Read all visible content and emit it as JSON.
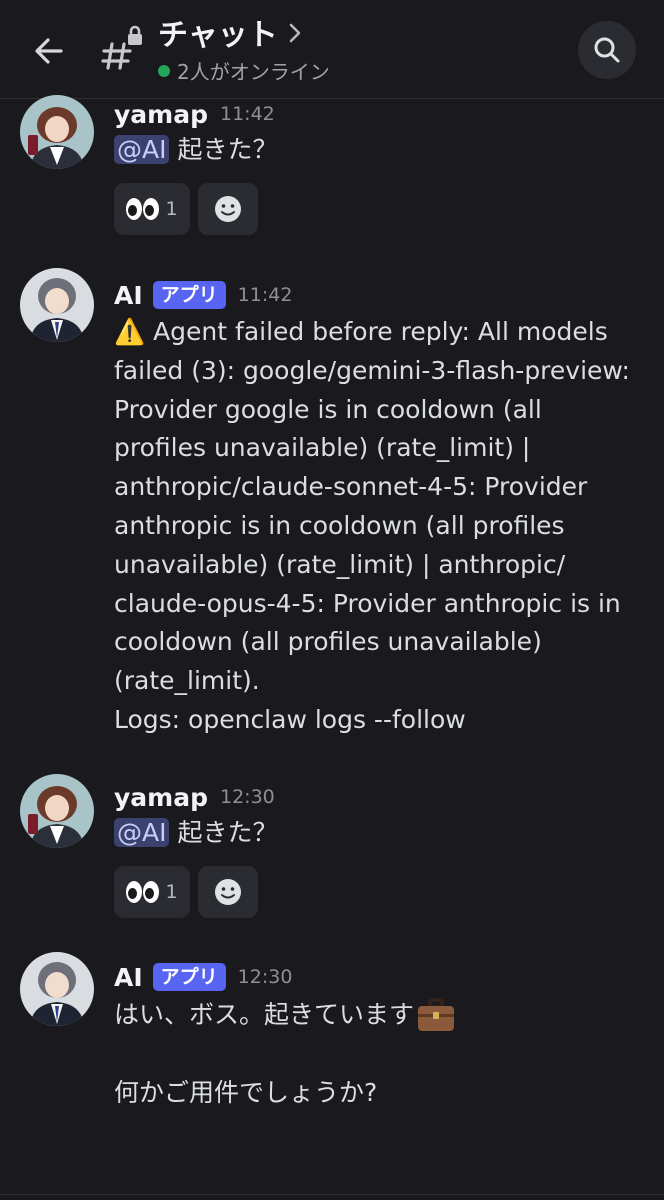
{
  "header": {
    "title": "チャット",
    "status": "2人がオンライン"
  },
  "messages": [
    {
      "author": "yamap",
      "time": "11:42",
      "mention": "@AI",
      "text": "起きた？",
      "reaction": {
        "emoji": "eyes",
        "count": "1"
      }
    },
    {
      "author": "AI",
      "badge": "アプリ",
      "time": "11:42",
      "lines": [
        "⚠️ Agent failed before reply: All models",
        "failed (3): google/gemini-3-flash-preview:",
        "Provider google is in cooldown (all",
        "profiles unavailable) (rate_limit) |",
        "anthropic/claude-sonnet-4-5: Provider",
        "anthropic is in cooldown (all profiles",
        "unavailable) (rate_limit) | anthropic/",
        "claude-opus-4-5: Provider anthropic is in",
        "cooldown (all profiles unavailable)",
        "(rate_limit).",
        "Logs: openclaw logs --follow"
      ]
    },
    {
      "author": "yamap",
      "time": "12:30",
      "mention": "@AI",
      "text": "起きた？",
      "reaction": {
        "emoji": "eyes",
        "count": "1"
      }
    },
    {
      "author": "AI",
      "badge": "アプリ",
      "time": "12:30",
      "line1": "はい、ボス。起きています",
      "line2": "何かご用件でしょうか?"
    }
  ],
  "colors": {
    "background": "#1a1a1e",
    "accent": "#5865f2",
    "online": "#23a55a",
    "mention_bg": "#3c4270"
  },
  "icons": [
    "back-arrow-icon",
    "channel-hashtag-lock-icon",
    "chevron-right-icon",
    "search-icon",
    "add-reaction-icon",
    "briefcase-emoji-icon"
  ]
}
